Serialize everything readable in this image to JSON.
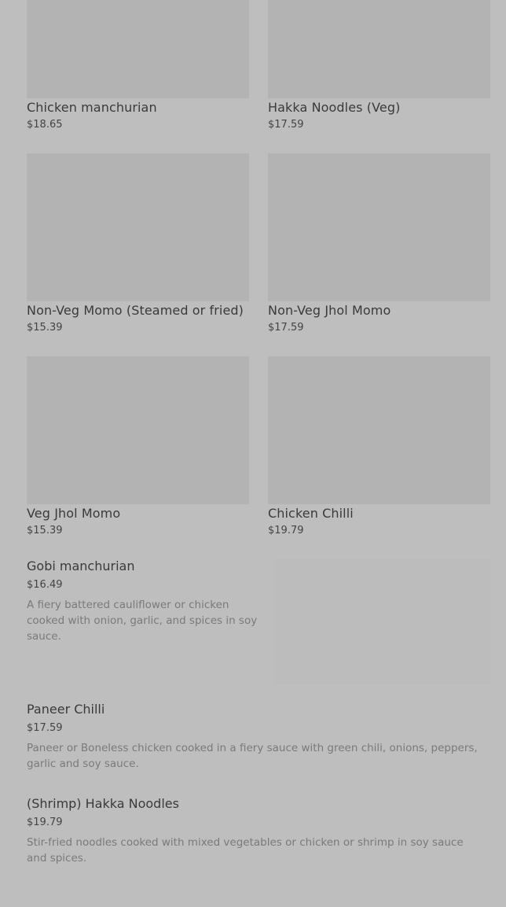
{
  "grid": [
    {
      "name": "Chicken manchurian",
      "price": "$18.65"
    },
    {
      "name": "Hakka Noodles (Veg)",
      "price": "$17.59"
    },
    {
      "name": "Non-Veg Momo (Steamed or fried)",
      "price": "$15.39"
    },
    {
      "name": "Non-Veg Jhol Momo",
      "price": "$17.59"
    },
    {
      "name": "Veg Jhol Momo",
      "price": "$15.39"
    },
    {
      "name": "Chicken Chilli",
      "price": "$19.79"
    }
  ],
  "list": [
    {
      "name": "Gobi manchurian",
      "price": "$16.49",
      "desc": "A fiery battered cauliflower or chicken cooked with onion, garlic, and spices in soy sauce."
    },
    {
      "name": "Paneer Chilli",
      "price": "$17.59",
      "desc": "Paneer or Boneless chicken cooked in a fiery sauce with green chili, onions, peppers, garlic and soy sauce."
    },
    {
      "name": "(Shrimp) Hakka Noodles",
      "price": "$19.79",
      "desc": "Stir-fried noodles cooked with mixed vegetables or chicken or shrimp in soy sauce and spices."
    }
  ]
}
